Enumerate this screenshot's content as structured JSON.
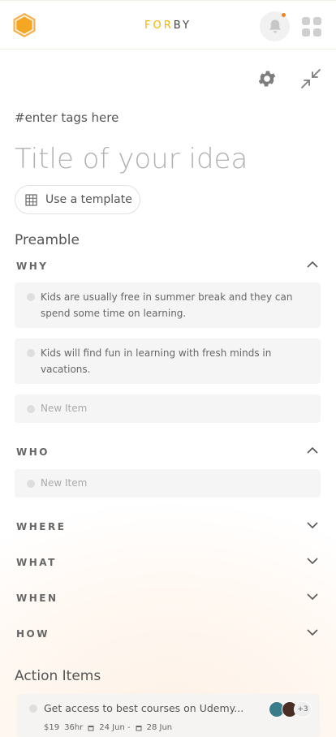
{
  "header": {
    "brand_part1": "FOR",
    "brand_part2": "BY"
  },
  "editor": {
    "tags_placeholder": "#enter tags here",
    "title_placeholder": "Title of your idea",
    "template_button": "Use a template"
  },
  "preamble": {
    "title": "Preamble",
    "why": {
      "label": "WHY",
      "items": [
        "Kids are usually free in summer break and they can spend some time on learning.",
        "Kids will find fun in learning with fresh minds in vacations."
      ],
      "new_item": "New Item"
    },
    "who": {
      "label": "WHO",
      "new_item": "New Item"
    },
    "where": {
      "label": "WHERE"
    },
    "what": {
      "label": "WHAT"
    },
    "when": {
      "label": "WHEN"
    },
    "how": {
      "label": "HOW"
    }
  },
  "action_items": {
    "title": "Action Items",
    "items": [
      {
        "text": "Get access to best courses on Udemy...",
        "cost": "$19",
        "duration": "36hr",
        "start": "24 Jun -",
        "end": "28 Jun",
        "more_assignees": "+3"
      }
    ]
  },
  "icons": {
    "logo": "hexagon-logo-icon",
    "bell": "bell-icon",
    "apps": "grid-icon",
    "settings": "gear-icon",
    "collapse": "collapse-icon",
    "template": "grid-table-icon",
    "calendar": "calendar-icon"
  },
  "colors": {
    "brand_accent": "#f4b400",
    "logo_orange": "#f5a623",
    "notification_dot": "#f4821f"
  }
}
